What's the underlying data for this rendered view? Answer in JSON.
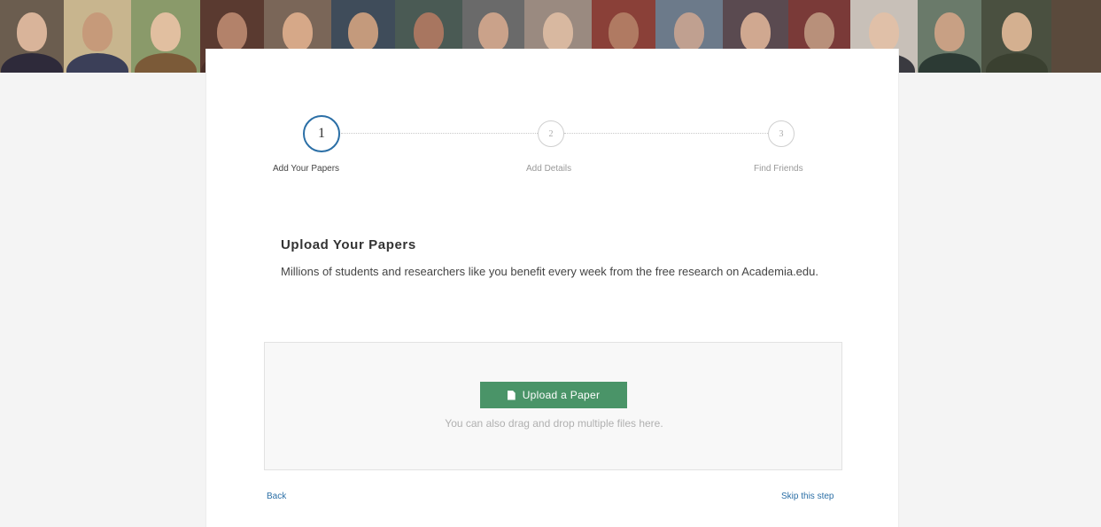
{
  "photo_strip": {
    "tiles": [
      {
        "w": 72,
        "bg": "#6b5d4f",
        "face": "#d9b49a",
        "body": "#2e2a3a"
      },
      {
        "w": 76,
        "bg": "#c8b58e",
        "face": "#c69a7a",
        "body": "#3b3f58"
      },
      {
        "w": 78,
        "bg": "#8a9a6a",
        "face": "#e1bfa0",
        "body": "#7b5a38"
      },
      {
        "w": 72,
        "bg": "#5a3a30",
        "face": "#b3826a",
        "body": "#4a2f28"
      },
      {
        "w": 76,
        "bg": "#7a6658",
        "face": "#d6a888",
        "body": "#2b2b2b"
      },
      {
        "w": 72,
        "bg": "#3f4c5a",
        "face": "#c49a7c",
        "body": "#1f1f1f"
      },
      {
        "w": 76,
        "bg": "#4a5a54",
        "face": "#a87660",
        "body": "#303a36"
      },
      {
        "w": 70,
        "bg": "#6a6a6a",
        "face": "#caa28a",
        "body": "#2a2a2a"
      },
      {
        "w": 76,
        "bg": "#9a8a80",
        "face": "#d8b8a0",
        "body": "#5a4a40"
      },
      {
        "w": 72,
        "bg": "#8a4038",
        "face": "#b07a62",
        "body": "#5a2820"
      },
      {
        "w": 76,
        "bg": "#6c7a8a",
        "face": "#c0a090",
        "body": "#3a4048"
      },
      {
        "w": 74,
        "bg": "#5a4a50",
        "face": "#d0a890",
        "body": "#2a2228"
      },
      {
        "w": 70,
        "bg": "#7a3a38",
        "face": "#b8907a",
        "body": "#4a2a28"
      },
      {
        "w": 76,
        "bg": "#c8c0b8",
        "face": "#e0c0a8",
        "body": "#3a3a40"
      },
      {
        "w": 72,
        "bg": "#6a7a6a",
        "face": "#c8a084",
        "body": "#2c3a34"
      },
      {
        "w": 79,
        "bg": "#4a5040",
        "face": "#d4b090",
        "body": "#3a4030"
      }
    ]
  },
  "stepper": {
    "steps": [
      {
        "number": "1",
        "label": "Add Your Papers",
        "active": true
      },
      {
        "number": "2",
        "label": "Add Details",
        "active": false
      },
      {
        "number": "3",
        "label": "Find Friends",
        "active": false
      }
    ]
  },
  "main": {
    "heading": "Upload Your Papers",
    "description": "Millions of students and researchers like you benefit every week from the free research on Academia.edu."
  },
  "dropzone": {
    "upload_label": "Upload a Paper",
    "hint": "You can also drag and drop multiple files here."
  },
  "footer": {
    "back_label": "Back",
    "skip_label": "Skip this step"
  },
  "colors": {
    "accent_green": "#4a9468",
    "link_blue": "#2b6fa6"
  }
}
